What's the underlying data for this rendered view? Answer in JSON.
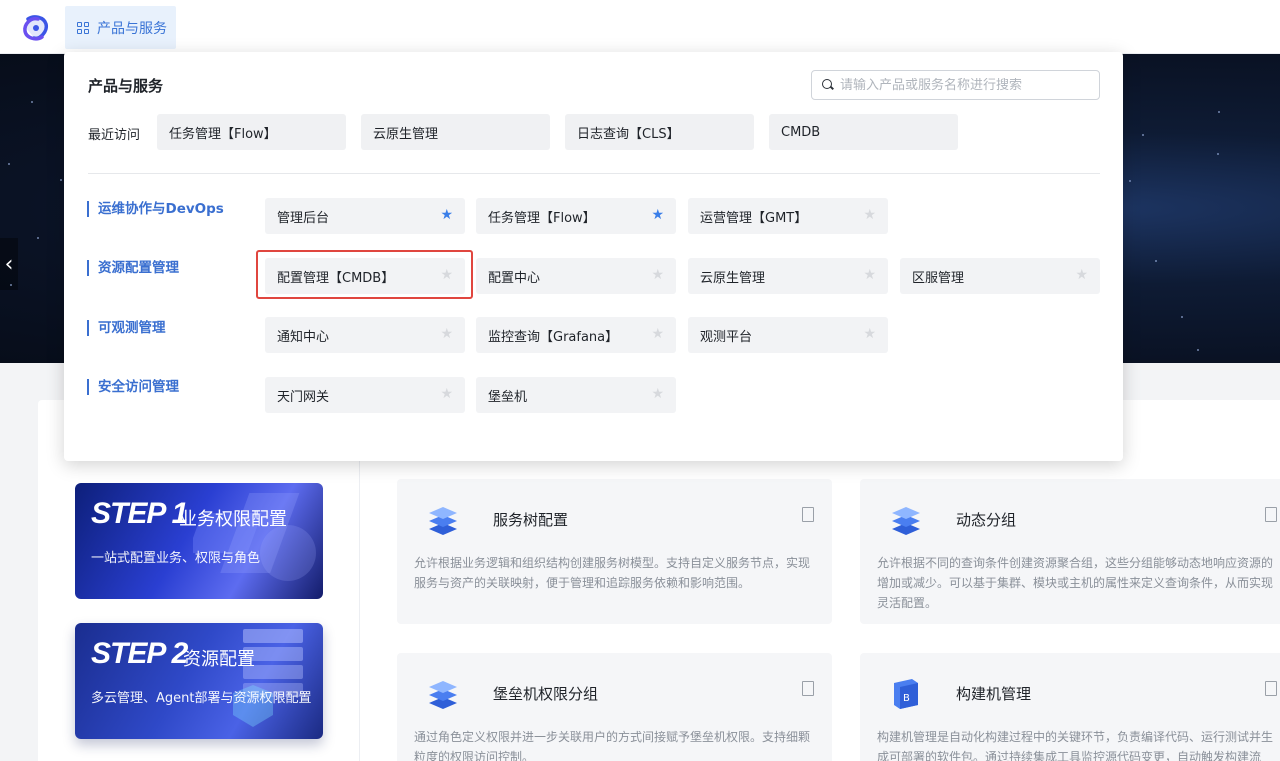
{
  "topbar": {
    "products_button_label": "产品与服务"
  },
  "panel": {
    "title": "产品与服务",
    "search_placeholder": "请输入产品或服务名称进行搜索",
    "recent_label": "最近访问",
    "recent_items": [
      "任务管理【Flow】",
      "云原生管理",
      "日志查询【CLS】",
      "CMDB"
    ],
    "categories": [
      {
        "label": "运维协作与DevOps",
        "items": [
          {
            "name": "管理后台",
            "starred": true
          },
          {
            "name": "任务管理【Flow】",
            "starred": true
          },
          {
            "name": "运营管理【GMT】",
            "starred": false
          }
        ]
      },
      {
        "label": "资源配置管理",
        "items": [
          {
            "name": "配置管理【CMDB】",
            "starred": false
          },
          {
            "name": "配置中心",
            "starred": false
          },
          {
            "name": "云原生管理",
            "starred": false
          },
          {
            "name": "区服管理",
            "starred": false
          }
        ]
      },
      {
        "label": "可观测管理",
        "items": [
          {
            "name": "通知中心",
            "starred": false
          },
          {
            "name": "监控查询【Grafana】",
            "starred": false
          },
          {
            "name": "观测平台",
            "starred": false
          }
        ]
      },
      {
        "label": "安全访问管理",
        "items": [
          {
            "name": "天门网关",
            "starred": false
          },
          {
            "name": "堡垒机",
            "starred": false
          }
        ]
      }
    ]
  },
  "steps": [
    {
      "badge": "STEP 1",
      "title": "业务权限配置",
      "desc": "一站式配置业务、权限与角色"
    },
    {
      "badge": "STEP 2",
      "title": "资源配置",
      "desc": "多云管理、Agent部署与资源权限配置"
    }
  ],
  "services": [
    {
      "title": "服务树配置",
      "desc": "允许根据业务逻辑和组织结构创建服务树模型。支持自定义服务节点，实现服务与资产的关联映射，便于管理和追踪服务依赖和影响范围。"
    },
    {
      "title": "动态分组",
      "desc": "允许根据不同的查询条件创建资源聚合组，这些分组能够动态地响应资源的增加或减少。可以基于集群、模块或主机的属性来定义查询条件，从而实现灵活配置。"
    },
    {
      "title": "堡垒机权限分组",
      "desc": "通过角色定义权限并进一步关联用户的方式间接赋予堡垒机权限。支持细颗粒度的权限访问控制。"
    },
    {
      "title": "构建机管理",
      "desc": "构建机管理是自动化构建过程中的关键环节，负责编译代码、运行测试并生成可部署的软件包。通过持续集成工具监控源代码变更，自动触发构建流程。"
    }
  ],
  "colors": {
    "accent": "#3a74d6",
    "highlight": "#e0463f",
    "star_on": "#3a7ee8",
    "star_off": "#d7d9dd"
  },
  "hero_nav": "‹"
}
